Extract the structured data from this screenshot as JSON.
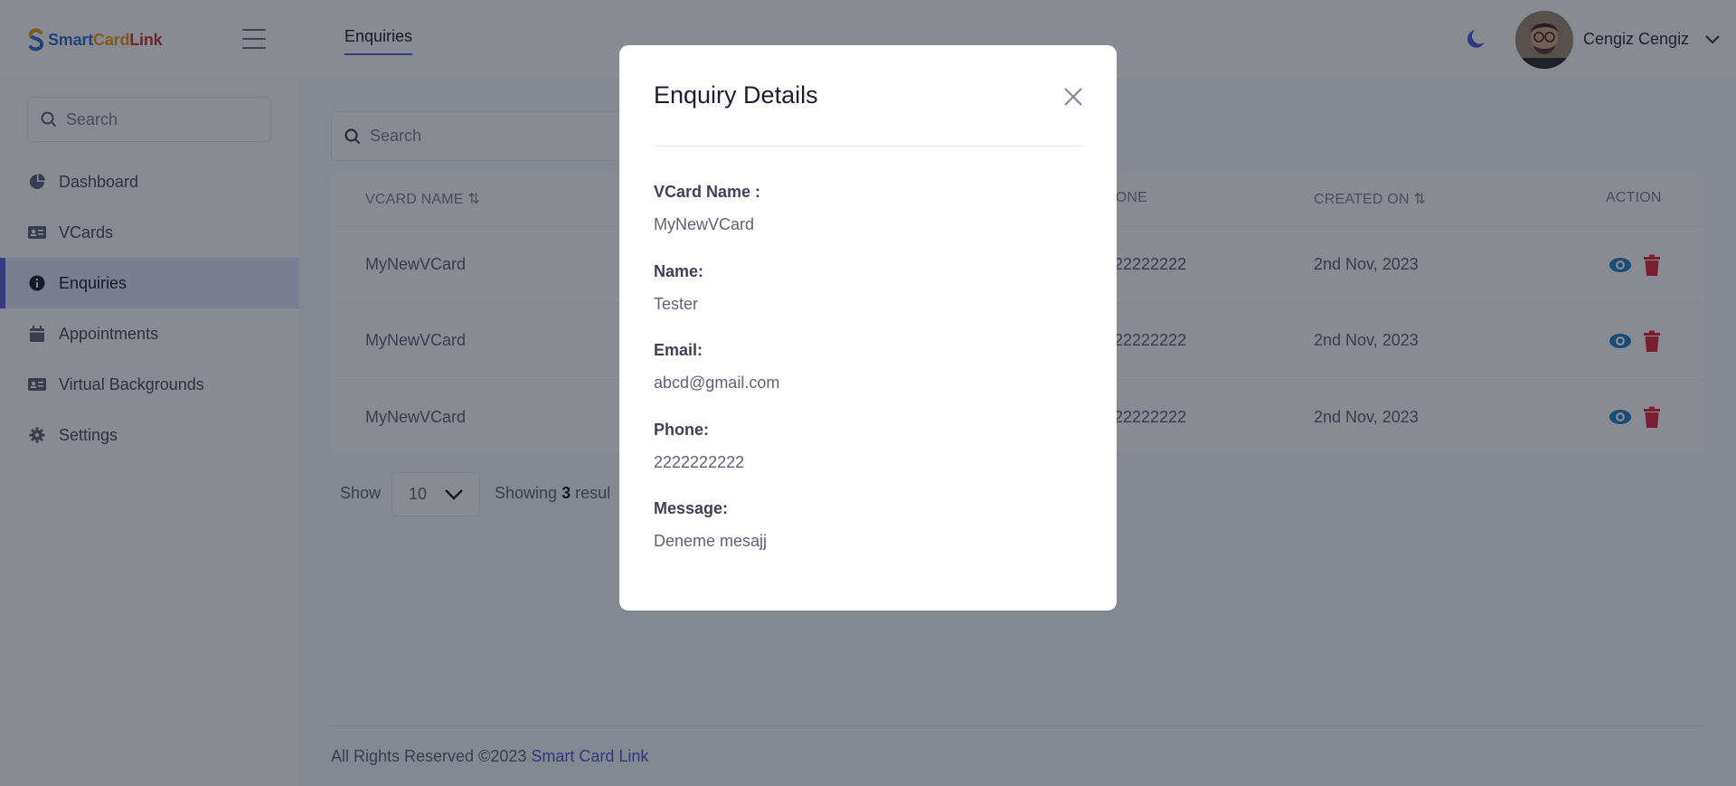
{
  "header": {
    "logo_text": [
      "Smart",
      "Card",
      "Link"
    ],
    "tab": "Enquiries",
    "user_name": "Cengiz Cengiz"
  },
  "sidebar": {
    "search_placeholder": "Search",
    "items": [
      {
        "label": "Dashboard",
        "icon": "pie-chart-icon"
      },
      {
        "label": "VCards",
        "icon": "id-card-icon"
      },
      {
        "label": "Enquiries",
        "icon": "info-circle-icon",
        "active": true
      },
      {
        "label": "Appointments",
        "icon": "calendar-icon"
      },
      {
        "label": "Virtual Backgrounds",
        "icon": "id-card-icon"
      },
      {
        "label": "Settings",
        "icon": "gear-icon"
      }
    ]
  },
  "main": {
    "search_placeholder": "Search",
    "table": {
      "columns": [
        "VCARD NAME",
        "PHONE",
        "CREATED ON",
        "ACTION"
      ],
      "visible_headers": [
        "VCARD NAME",
        "HONE",
        "CREATED ON",
        "ACTION"
      ],
      "rows": [
        {
          "vcard_name": "MyNewVCard",
          "phone": "2222222222",
          "phone_visible": "222222222",
          "created_on": "2nd Nov, 2023"
        },
        {
          "vcard_name": "MyNewVCard",
          "phone": "2222222222",
          "phone_visible": "222222222",
          "created_on": "2nd Nov, 2023"
        },
        {
          "vcard_name": "MyNewVCard",
          "phone": "2222222222",
          "phone_visible": "222222222",
          "created_on": "2nd Nov, 2023"
        }
      ]
    },
    "pagination": {
      "show_label": "Show",
      "per_page": "10",
      "showing_prefix": "Showing",
      "showing_count": "3",
      "showing_suffix": "resul"
    },
    "footer": {
      "text": "All Rights Reserved ©2023",
      "brand": "Smart Card Link"
    }
  },
  "modal": {
    "title": "Enquiry Details",
    "fields": [
      {
        "label": "VCard Name :",
        "value": "MyNewVCard"
      },
      {
        "label": "Name:",
        "value": "Tester"
      },
      {
        "label": "Email:",
        "value": "abcd@gmail.com"
      },
      {
        "label": "Phone:",
        "value": "2222222222"
      },
      {
        "label": "Message:",
        "value": "Deneme mesajj"
      }
    ]
  },
  "colors": {
    "accent": "#5a5fe0",
    "view_icon": "#1e7fc7",
    "delete_icon": "#e0233a",
    "overlay": "rgba(20,24,38,0.5)"
  }
}
